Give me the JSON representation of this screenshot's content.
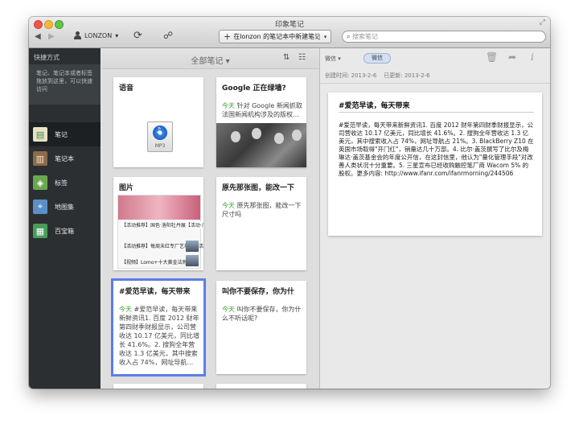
{
  "window": {
    "title": "印象笔记"
  },
  "toolbar": {
    "back": "◀",
    "forward": "▶",
    "user": "LONZON",
    "user_caret": "▾",
    "new_note_plus": "+",
    "new_note_label": "在lonzon 的笔记本中新建笔记",
    "new_note_caret": "▾",
    "search_placeholder": "搜索笔记"
  },
  "sidebar": {
    "shortcuts_header": "快捷方式",
    "shortcuts_hint": "笔记、笔记本或者标签拖放到这里，可以快速访问",
    "items": [
      {
        "label": "笔记",
        "icon": "notes-icon",
        "active": true
      },
      {
        "label": "笔记本",
        "icon": "notebooks-icon",
        "active": false
      },
      {
        "label": "标签",
        "icon": "tags-icon",
        "active": false
      },
      {
        "label": "地图集",
        "icon": "atlas-icon",
        "active": false
      },
      {
        "label": "百宝箱",
        "icon": "market-icon",
        "active": false
      }
    ]
  },
  "notelist": {
    "title": "全部笔记",
    "title_caret": "▾",
    "sort_label": "⇅",
    "view_label": "☷",
    "notes": [
      {
        "title": "语音",
        "date": "",
        "snippet": "",
        "thumb_label": "MP3"
      },
      {
        "title": "Google 正在绿墙?",
        "date": "今天",
        "snippet": "针对 Google 新闻抓取法国新闻机构涉及的版权…"
      },
      {
        "title": "图片",
        "date": "",
        "snippet": "",
        "thumb_lines": [
          "【活动推荐】国色·洛阳牡丹展【活动·广州】",
          "【活动推荐】每周末红专厂艺墟见【活动·广州】",
          "【视频】Lomo+十大黄金法则"
        ]
      },
      {
        "title": "原先那张图，能改一下",
        "date": "今天",
        "snippet": "原先那张图，能改一下尺寸吗"
      },
      {
        "title": "#爱范早读，每天带来",
        "date": "今天",
        "snippet": "#爱范早读，每天带来新鲜资讯1. 百度 2012 财年第四财季财报显示，公司营收达 10.17 亿美元，同比增长 41.6%。2. 搜狗全年营收达 1.3 亿美元，其中搜索收入占 74%，网址导航…"
      },
      {
        "title": "叫你不要保存，你为什",
        "date": "今天",
        "snippet": "叫你不要保存，你为什么不听话呢?"
      }
    ]
  },
  "editor": {
    "notebook": "微信",
    "notebook_caret": "▾",
    "tag": "微信",
    "created": "创建时间: 2013-2-6",
    "updated": "已更新: 2013-2-6",
    "trash_icon": "🗑",
    "share_icon": "➦",
    "info_icon": "i",
    "note_title": "#爱范早读，每天带来",
    "note_body": "#爱范早读，每天带来新鲜资讯1. 百度 2012 财年第四财季财报显示，公司营收达 10.17 亿美元，同比增长 41.6%。2. 搜狗全年营收达 1.3 亿美元，其中搜索收入占 74%，网址导航占 21%。3. BlackBerry Z10 在英国市场取得\"开门红\"，销量达几十万部。4. 比尔·盖茨撰写了比尔及梅琳达·盖茨基金会的年度公开信，在这封信里，他认为\"量化管理手段\"对改善人类状况十分重要。5. 三星宣布已经收购触控笔厂商 Wacom 5% 的股权。更多内容: http://www.ifanr.com/ifanrmorning/244506"
  },
  "colors": {
    "sidebar_bg": "#2b2f32",
    "selection": "#5c7ee4",
    "today": "#3fa538"
  }
}
